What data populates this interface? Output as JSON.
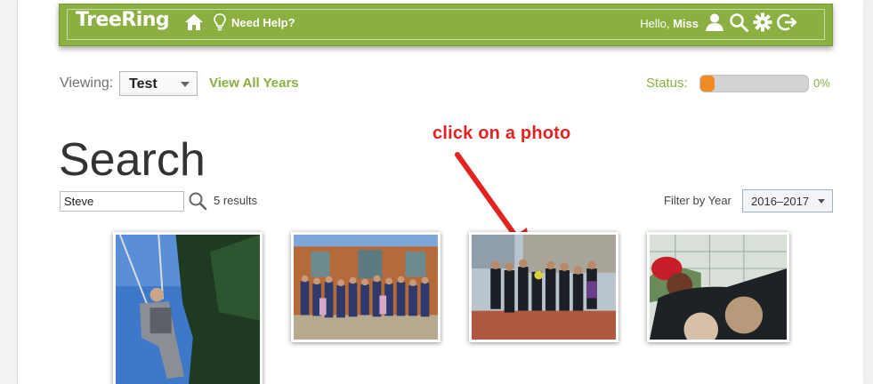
{
  "header": {
    "logo": "TreeRing",
    "help": "Need Help?",
    "greeting_prefix": "Hello,",
    "greeting_name": "Miss",
    "icons": [
      "home-icon",
      "lightbulb-icon",
      "user-icon",
      "search-icon",
      "gear-icon",
      "logout-icon"
    ],
    "color": "#8bb041"
  },
  "viewing": {
    "label": "Viewing:",
    "selected": "Test",
    "view_all": "View All Years"
  },
  "status": {
    "label": "Status:",
    "percent_text": "0%",
    "progress": 0,
    "fill_color": "#f08a22"
  },
  "page_title": "Search",
  "annotation": {
    "text": "click on a photo",
    "color": "#e3231f"
  },
  "search": {
    "value": "Steve",
    "results": "5 results"
  },
  "filter": {
    "label": "Filter by Year",
    "selected": "2016–2017"
  }
}
